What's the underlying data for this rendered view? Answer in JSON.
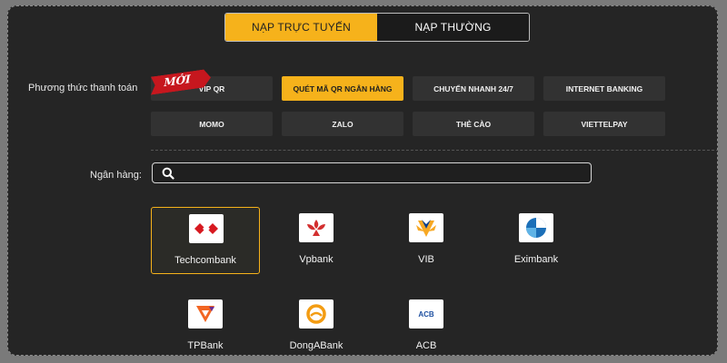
{
  "tabs": [
    {
      "label": "NẠP TRỰC TUYẾN",
      "active": true
    },
    {
      "label": "NẠP THƯỜNG",
      "active": false
    }
  ],
  "payment": {
    "label": "Phương thức thanh toán",
    "new_badge": "MỚI",
    "methods": [
      {
        "label": "VIP QR",
        "active": false
      },
      {
        "label": "QUÉT MÃ QR NGÂN HÀNG",
        "active": true
      },
      {
        "label": "CHUYỂN NHANH 24/7",
        "active": false
      },
      {
        "label": "INTERNET BANKING",
        "active": false
      },
      {
        "label": "MOMO",
        "active": false
      },
      {
        "label": "ZALO",
        "active": false
      },
      {
        "label": "THẺ CÀO",
        "active": false
      },
      {
        "label": "VIETTELPAY",
        "active": false
      }
    ]
  },
  "bank_section": {
    "label": "Ngân hàng:",
    "search_value": "",
    "search_placeholder": ""
  },
  "banks": [
    {
      "name": "Techcombank",
      "icon": "techcombank-logo",
      "selected": true
    },
    {
      "name": "Vpbank",
      "icon": "vpbank-logo",
      "selected": false
    },
    {
      "name": "VIB",
      "icon": "vib-logo",
      "selected": false
    },
    {
      "name": "Eximbank",
      "icon": "eximbank-logo",
      "selected": false
    },
    {
      "name": "TPBank",
      "icon": "tpbank-logo",
      "selected": false
    },
    {
      "name": "DongABank",
      "icon": "dongabank-logo",
      "selected": false
    },
    {
      "name": "ACB",
      "icon": "acb-logo",
      "selected": false,
      "logo_text": "ACB"
    }
  ],
  "colors": {
    "accent": "#f6b21b",
    "panel": "#252525",
    "badge": "#c6171e"
  }
}
